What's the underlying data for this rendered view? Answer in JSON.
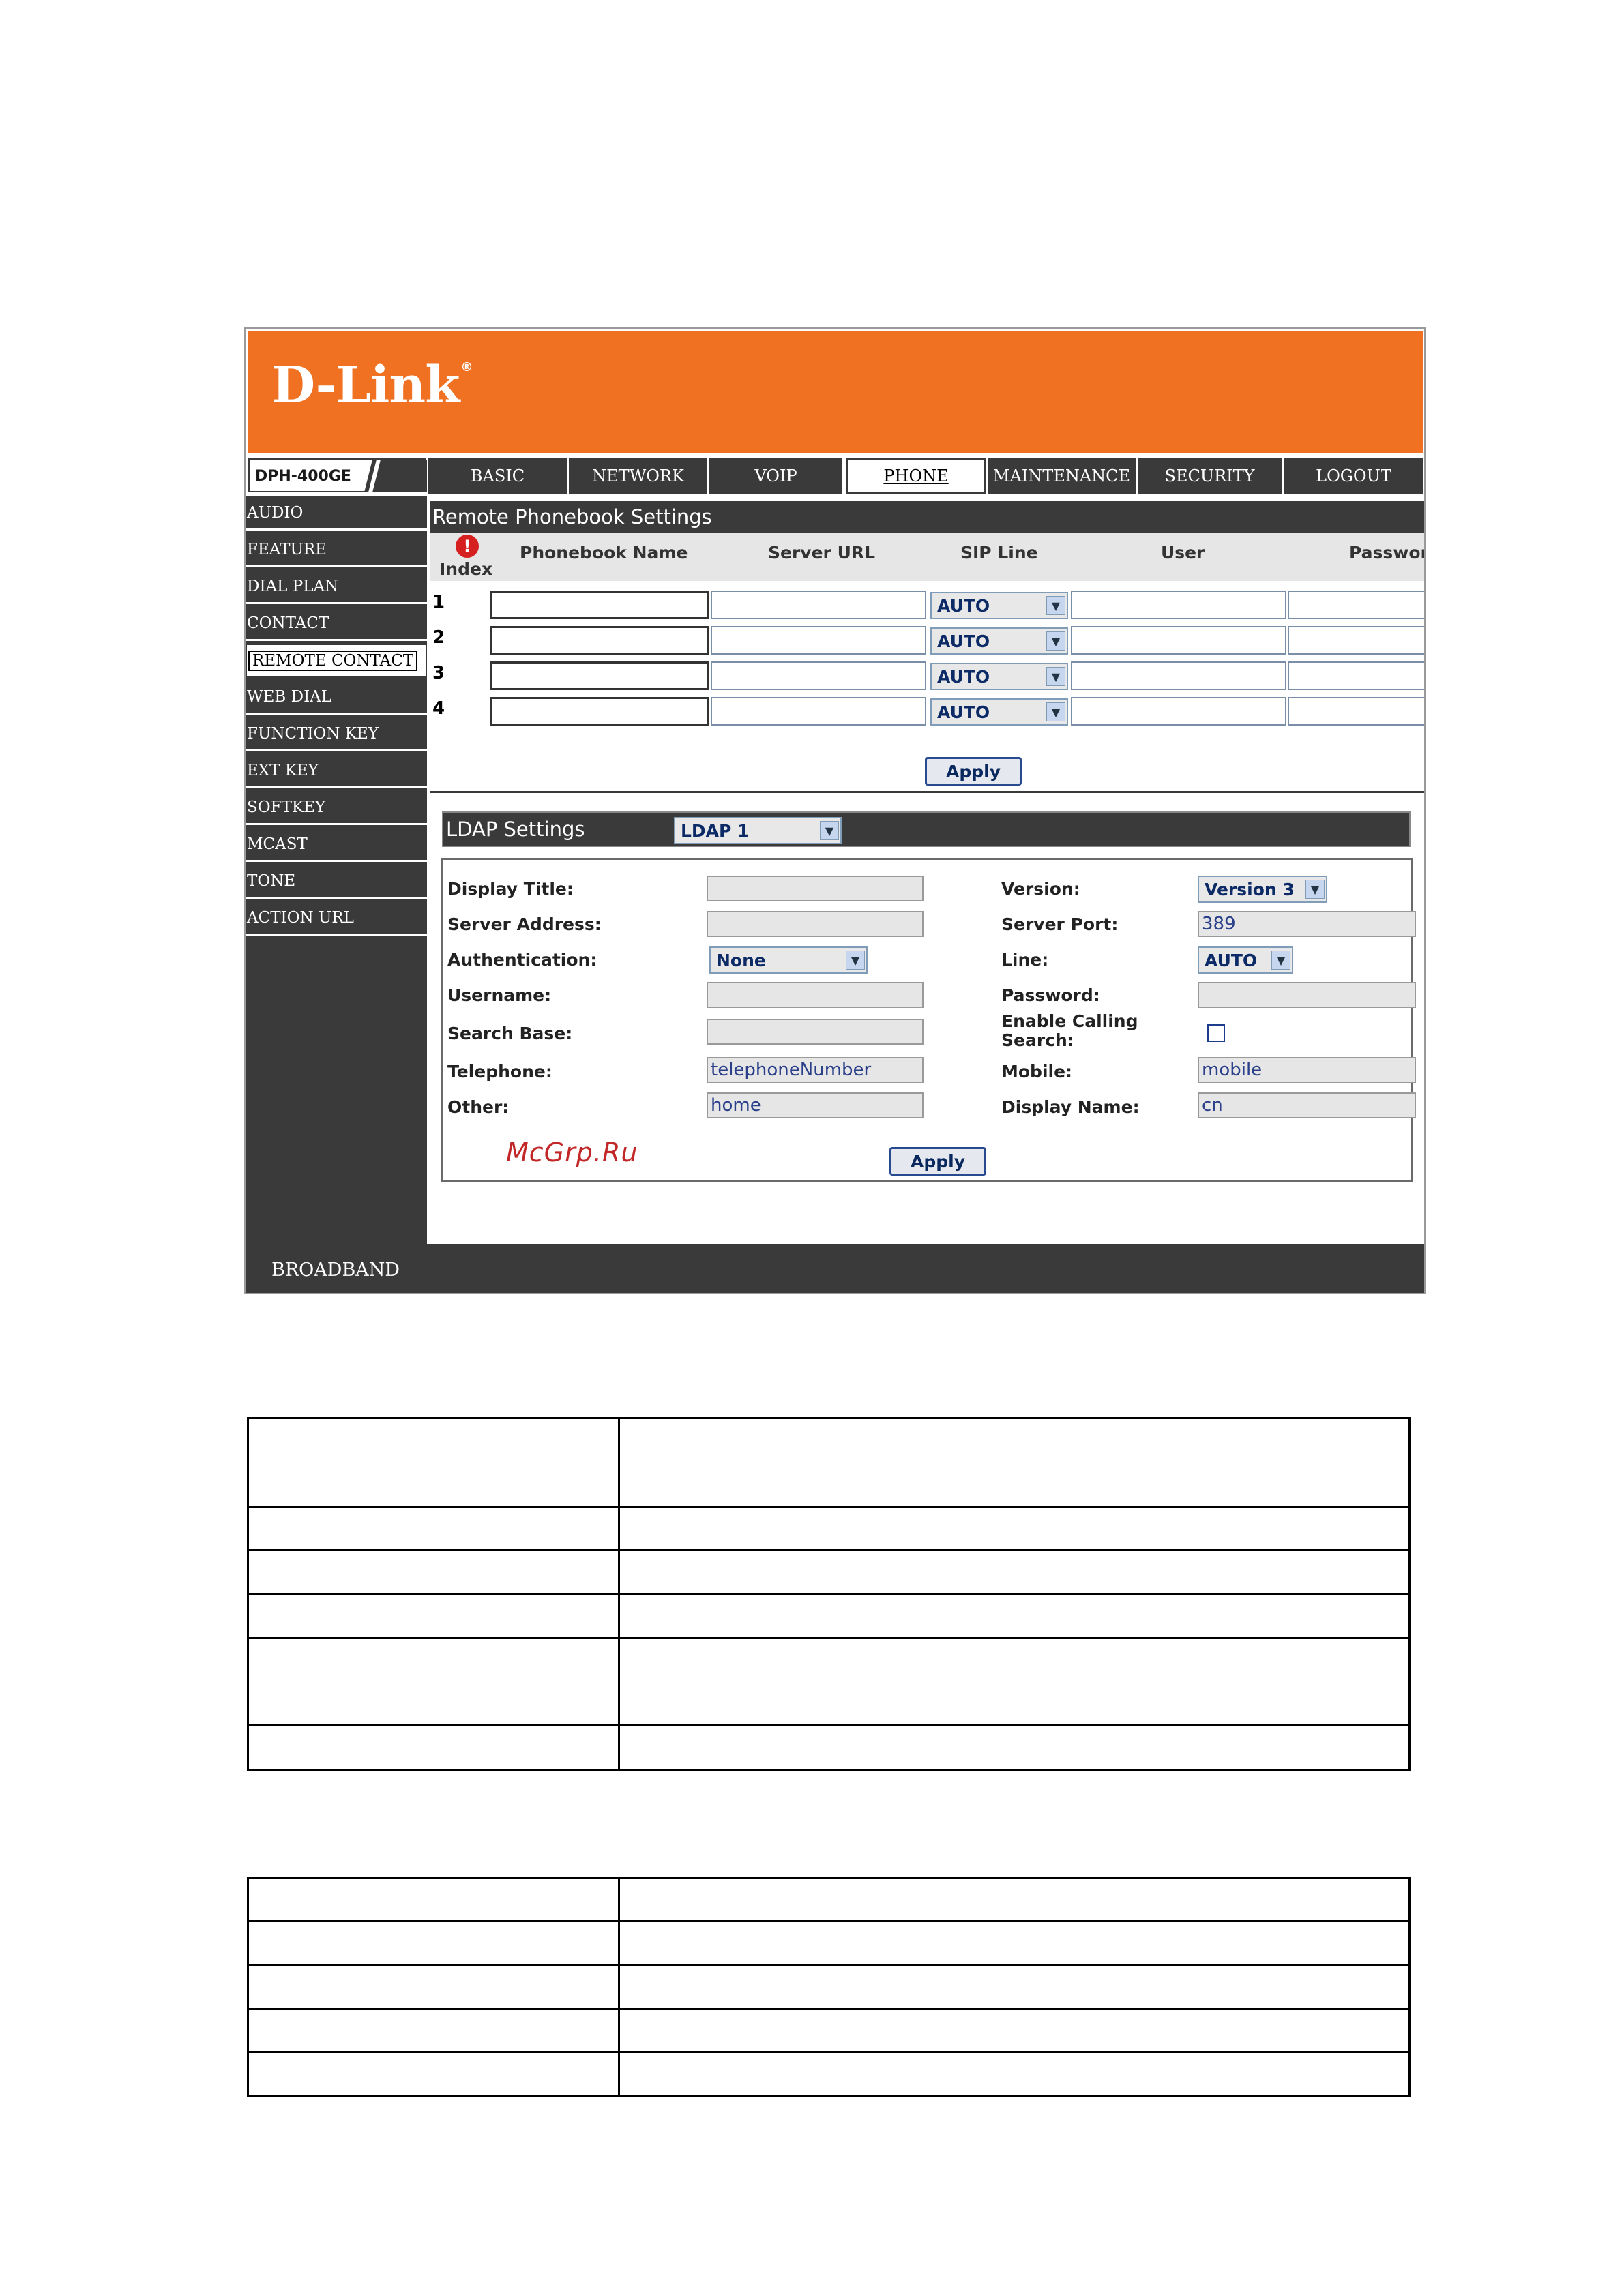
{
  "header": {
    "logo_text": "D-Link",
    "logo_mark": "®"
  },
  "navbar": {
    "model": "DPH-400GE",
    "tabs": [
      "BASIC",
      "NETWORK",
      "VOIP",
      "PHONE",
      "MAINTENANCE",
      "SECURITY",
      "LOGOUT"
    ],
    "active_tab": "PHONE"
  },
  "sidebar": {
    "items": [
      "AUDIO",
      "FEATURE",
      "DIAL PLAN",
      "CONTACT",
      "REMOTE CONTACT",
      "WEB DIAL",
      "FUNCTION KEY",
      "EXT KEY",
      "SOFTKEY",
      "MCAST",
      "TONE",
      "ACTION URL"
    ],
    "active": "REMOTE CONTACT"
  },
  "remote_phonebook": {
    "title": "Remote Phonebook Settings",
    "index_icon": "!",
    "columns": [
      "Index",
      "Phonebook Name",
      "Server URL",
      "SIP Line",
      "User",
      "Password"
    ],
    "rows": [
      {
        "index": "1",
        "sip_line": "AUTO"
      },
      {
        "index": "2",
        "sip_line": "AUTO"
      },
      {
        "index": "3",
        "sip_line": "AUTO"
      },
      {
        "index": "4",
        "sip_line": "AUTO"
      }
    ],
    "apply_label": "Apply"
  },
  "ldap": {
    "title": "LDAP Settings",
    "selector_value": "LDAP 1",
    "left_labels": [
      "Display Title:",
      "Server Address:",
      "Authentication:",
      "Username:",
      "Search Base:",
      "Telephone:",
      "Other:"
    ],
    "right_labels": [
      "Version:",
      "Server Port:",
      "Line:",
      "Password:",
      "Enable Calling\nSearch:",
      "Mobile:",
      "Display Name:"
    ],
    "authentication_value": "None",
    "version_value": "Version 3",
    "server_port_value": "389",
    "line_value": "AUTO",
    "telephone_value": "telephoneNumber",
    "other_value": "home",
    "mobile_value": "mobile",
    "display_name_value": "cn",
    "apply_label": "Apply"
  },
  "watermark": "McGrp.Ru",
  "footer": {
    "label": "BROADBAND"
  },
  "icons": {
    "dropdown": "chevron-down-icon",
    "alert": "alert-icon"
  }
}
